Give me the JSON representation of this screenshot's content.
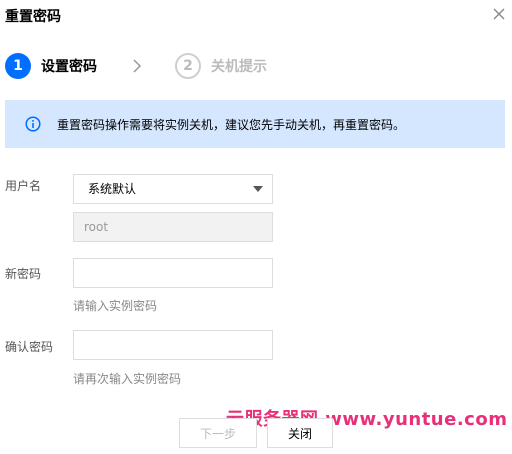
{
  "dialog": {
    "title": "重置密码"
  },
  "steps": [
    {
      "number": "1",
      "label": "设置密码",
      "state": "active"
    },
    {
      "number": "2",
      "label": "关机提示",
      "state": "inactive"
    }
  ],
  "notice": {
    "icon": "info-icon",
    "text": "重置密码操作需要将实例关机，建议您先手动关机，再重置密码。"
  },
  "form": {
    "username": {
      "label": "用户名",
      "select_value": "系统默认",
      "input_value": "root"
    },
    "new_password": {
      "label": "新密码",
      "value": "",
      "hint": "请输入实例密码"
    },
    "confirm_password": {
      "label": "确认密码",
      "value": "",
      "hint": "请再次输入实例密码"
    }
  },
  "buttons": {
    "next": "下一步",
    "close": "关闭"
  },
  "watermark": "云服务器网 www.yuntue.com",
  "colors": {
    "primary": "#006eff",
    "notice_bg": "#d5e7ff",
    "watermark": "#e8307a"
  }
}
